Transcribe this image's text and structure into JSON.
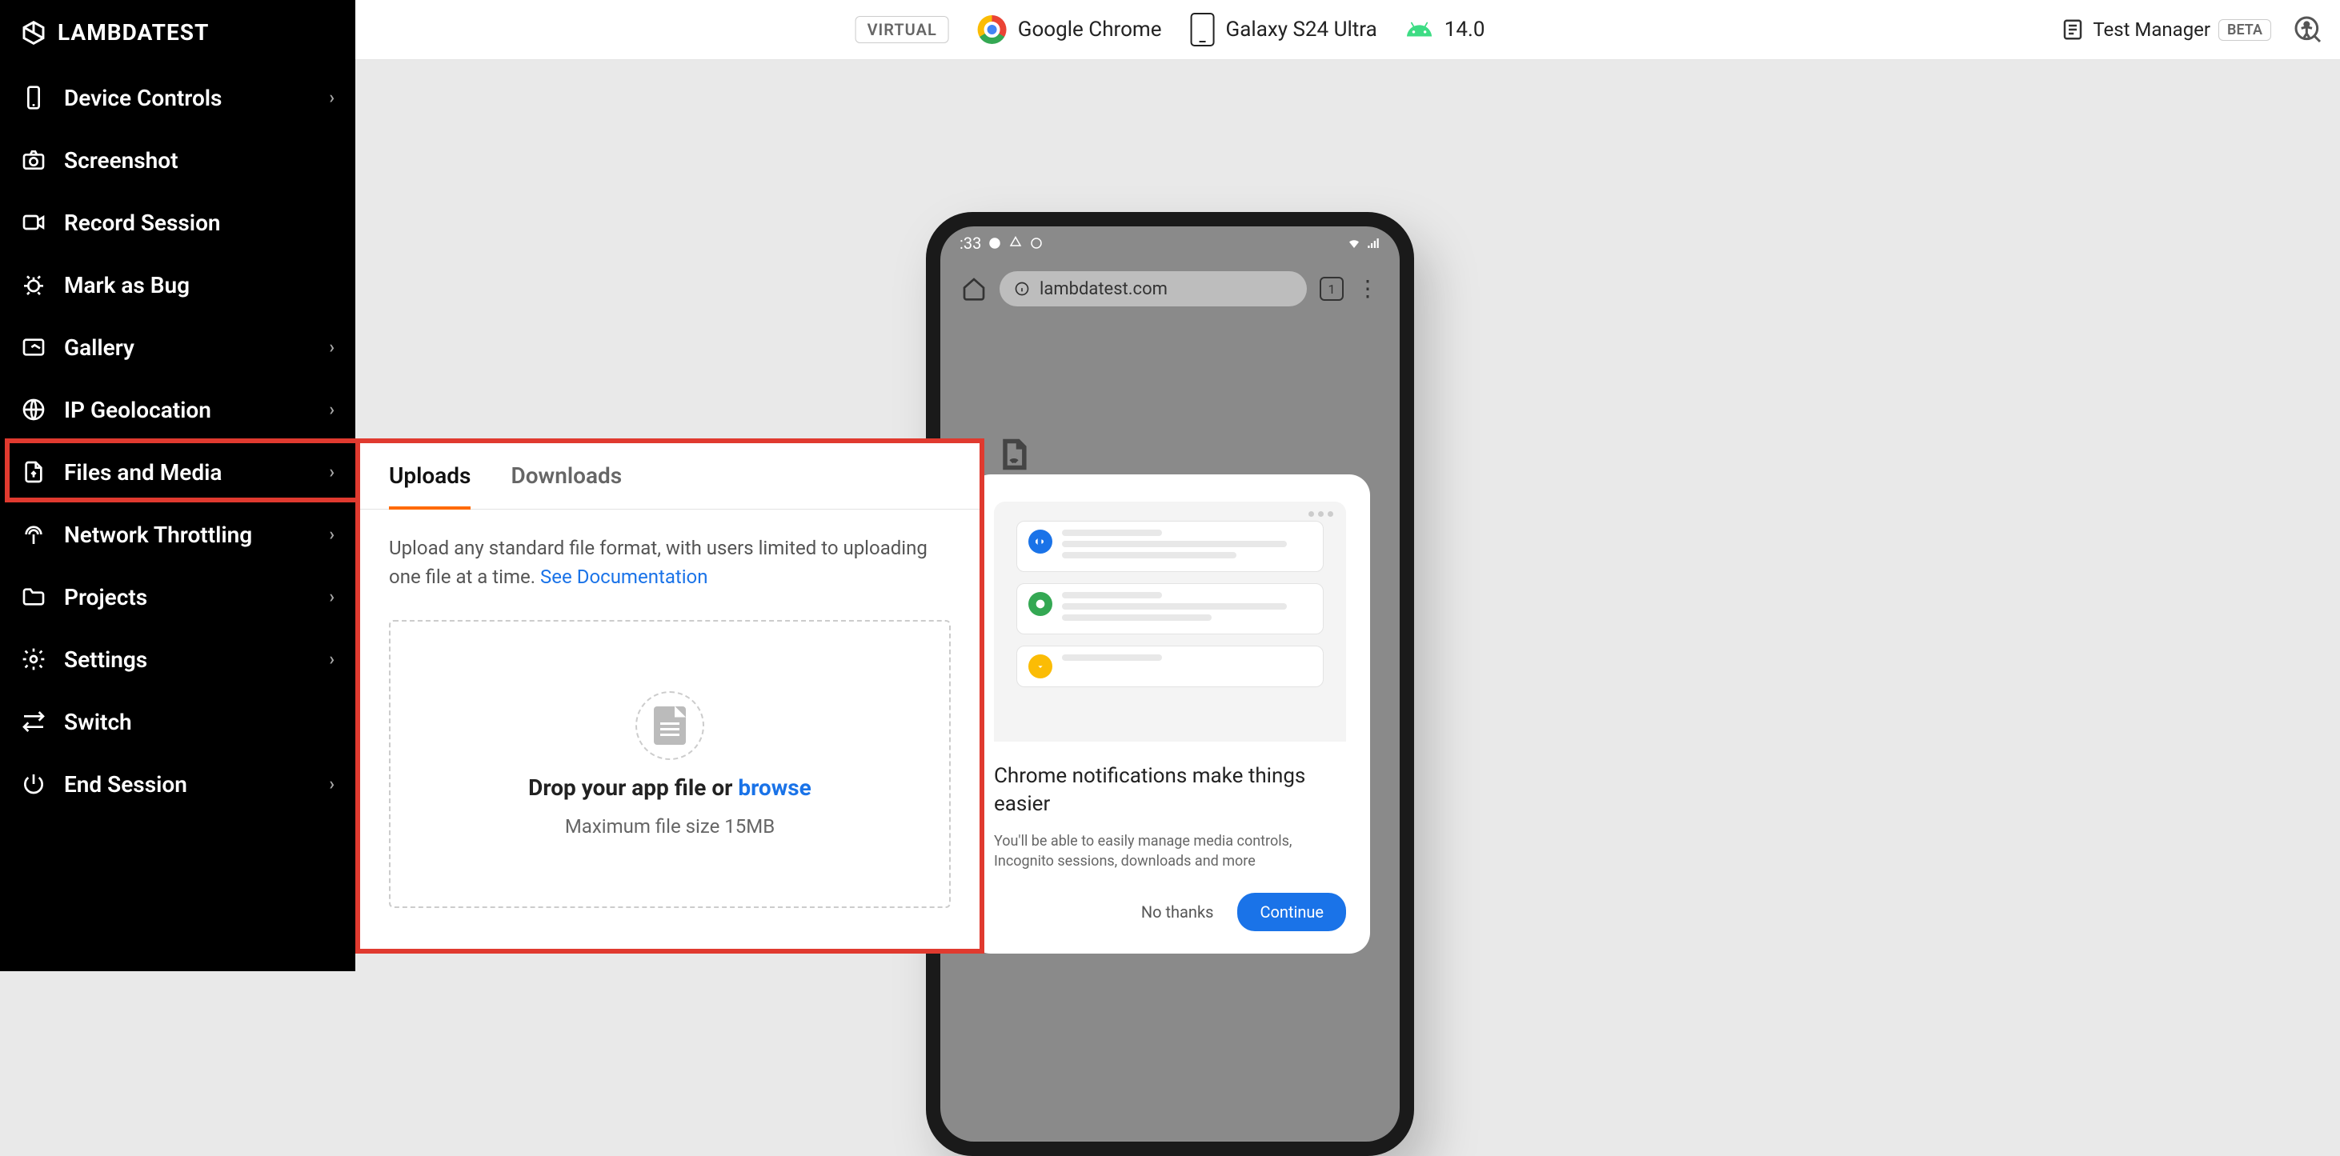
{
  "brand": "LAMBDATEST",
  "topbar": {
    "virtual_badge": "VIRTUAL",
    "browser": "Google Chrome",
    "device": "Galaxy S24 Ultra",
    "os_version": "14.0",
    "test_manager": "Test Manager",
    "beta": "BETA"
  },
  "sidebar": {
    "items": [
      {
        "label": "Device Controls",
        "chev": true
      },
      {
        "label": "Screenshot"
      },
      {
        "label": "Record Session"
      },
      {
        "label": "Mark as Bug"
      },
      {
        "label": "Gallery",
        "chev": true
      },
      {
        "label": "IP Geolocation",
        "chev": true
      },
      {
        "label": "Files and Media",
        "chev": true
      },
      {
        "label": "Network Throttling",
        "chev": true
      },
      {
        "label": "Projects",
        "chev": true
      },
      {
        "label": "Settings",
        "chev": true
      },
      {
        "label": "Switch"
      },
      {
        "label": "End Session",
        "chev": true
      }
    ]
  },
  "panel": {
    "tabs": {
      "uploads": "Uploads",
      "downloads": "Downloads"
    },
    "desc_pre": "Upload any standard file format, with users limited to uploading one file at a time. ",
    "doc_link": "See Documentation",
    "drop_text_pre": "Drop your app file or ",
    "drop_browse": "browse",
    "drop_sub": "Maximum file size 15MB"
  },
  "phone": {
    "time": ":33",
    "url": "lambdatest.com",
    "tab_count": "1",
    "modal": {
      "title": "Chrome notifications make things easier",
      "sub": "You'll be able to easily manage media controls, Incognito sessions, downloads and more",
      "no_thanks": "No thanks",
      "continue": "Continue"
    }
  }
}
